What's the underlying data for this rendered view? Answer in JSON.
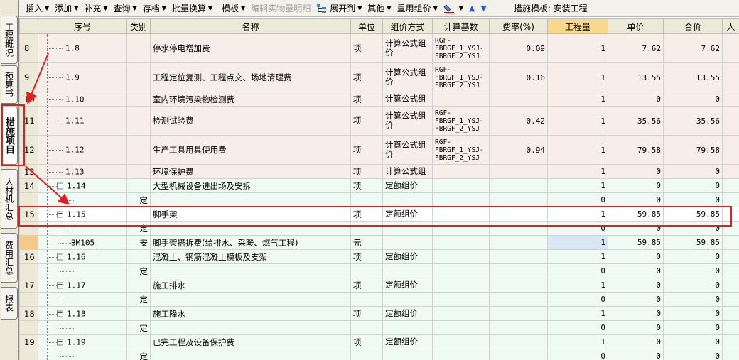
{
  "sidebar": {
    "tabs": [
      {
        "label": "工程概况",
        "active": false
      },
      {
        "label": "预算书",
        "active": false
      },
      {
        "label": "措施项目",
        "active": true
      },
      {
        "label": "人材机汇总",
        "active": false
      },
      {
        "label": "费用汇总",
        "active": false
      },
      {
        "label": "报表",
        "active": false
      }
    ]
  },
  "toolbar": {
    "insert": "插入",
    "add": "添加",
    "supplement": "补充",
    "query": "查询",
    "archive": "存档",
    "batch_convert": "批量换算",
    "template": "模板",
    "edit_material": "编辑实物量明细",
    "expand_to": "展开到",
    "other": "其他",
    "regroup": "重用组价",
    "template_label": "措施模板: 安装工程"
  },
  "columns": [
    "",
    "序号",
    "类别",
    "名称",
    "单位",
    "组价方式",
    "计算基数",
    "费率(%)",
    "工程量",
    "单价",
    "合价",
    "人"
  ],
  "rows": [
    {
      "n": "8",
      "code": "1.8",
      "cat": "",
      "name": "停水停电增加费",
      "unit": "项",
      "method": "计算公式组价",
      "base": "RGF-FBRGF_1_YSJ-FBRGF_2_YSJ",
      "rate": "0.09",
      "qty": "1",
      "price": "7.62",
      "total": "7.62"
    },
    {
      "n": "9",
      "code": "1.9",
      "cat": "",
      "name": "工程定位复测、工程点交、场地清理费",
      "unit": "项",
      "method": "计算公式组价",
      "base": "RGF-FBRGF_1_YSJ-FBRGF_2_YSJ",
      "rate": "0.16",
      "qty": "1",
      "price": "13.55",
      "total": "13.55"
    },
    {
      "n": "10",
      "code": "1.10",
      "cat": "",
      "name": "室内环境污染物检测费",
      "unit": "项",
      "method": "计算公式组",
      "base": "",
      "rate": "",
      "qty": "1",
      "price": "0",
      "total": "0"
    },
    {
      "n": "11",
      "code": "1.11",
      "cat": "",
      "name": "检测试验费",
      "unit": "项",
      "method": "计算公式组价",
      "base": "RGF-FBRGF_1_YSJ-FBRGF_2_YSJ",
      "rate": "0.42",
      "qty": "1",
      "price": "35.56",
      "total": "35.56"
    },
    {
      "n": "12",
      "code": "1.12",
      "cat": "",
      "name": "生产工具用具使用费",
      "unit": "项",
      "method": "计算公式组价",
      "base": "RGF-FBRGF_1_YSJ-FBRGF_2_YSJ",
      "rate": "0.94",
      "qty": "1",
      "price": "79.58",
      "total": "79.58"
    },
    {
      "n": "13",
      "code": "1.13",
      "cat": "",
      "name": "环境保护费",
      "unit": "项",
      "method": "计算公式组",
      "base": "",
      "rate": "",
      "qty": "1",
      "price": "0",
      "total": "0"
    },
    {
      "n": "14",
      "code": "1.14",
      "cat": "",
      "name": "大型机械设备进出场及安拆",
      "unit": "项",
      "method": "定额组价",
      "base": "",
      "rate": "",
      "qty": "1",
      "price": "0",
      "total": "0"
    },
    {
      "n": "",
      "code": "",
      "cat": "定",
      "name": "",
      "unit": "",
      "method": "",
      "base": "",
      "rate": "",
      "qty": "0",
      "price": "0",
      "total": "0"
    },
    {
      "n": "15",
      "code": "1.15",
      "cat": "",
      "name": "脚手架",
      "unit": "项",
      "method": "定额组价",
      "base": "",
      "rate": "",
      "qty": "1",
      "price": "59.85",
      "total": "59.85"
    },
    {
      "n": "",
      "code": "",
      "cat": "定",
      "name": "",
      "unit": "",
      "method": "",
      "base": "",
      "rate": "",
      "qty": "0",
      "price": "0",
      "total": "0"
    },
    {
      "n": "",
      "code": "BM105",
      "cat": "安",
      "name": "脚手架搭拆费(给排水、采暖、燃气工程)",
      "unit": "元",
      "method": "",
      "base": "",
      "rate": "",
      "qty": "1",
      "price": "59.85",
      "total": "59.85"
    },
    {
      "n": "16",
      "code": "1.16",
      "cat": "",
      "name": "混凝土、钢筋混凝土模板及支架",
      "unit": "项",
      "method": "定额组价",
      "base": "",
      "rate": "",
      "qty": "1",
      "price": "0",
      "total": "0"
    },
    {
      "n": "",
      "code": "",
      "cat": "定",
      "name": "",
      "unit": "",
      "method": "",
      "base": "",
      "rate": "",
      "qty": "0",
      "price": "0",
      "total": "0"
    },
    {
      "n": "17",
      "code": "1.17",
      "cat": "",
      "name": "施工排水",
      "unit": "项",
      "method": "定额组价",
      "base": "",
      "rate": "",
      "qty": "1",
      "price": "0",
      "total": "0"
    },
    {
      "n": "",
      "code": "",
      "cat": "定",
      "name": "",
      "unit": "",
      "method": "",
      "base": "",
      "rate": "",
      "qty": "0",
      "price": "0",
      "total": "0"
    },
    {
      "n": "18",
      "code": "1.18",
      "cat": "",
      "name": "施工降水",
      "unit": "项",
      "method": "定额组价",
      "base": "",
      "rate": "",
      "qty": "1",
      "price": "0",
      "total": "0"
    },
    {
      "n": "",
      "code": "",
      "cat": "定",
      "name": "",
      "unit": "",
      "method": "",
      "base": "",
      "rate": "",
      "qty": "0",
      "price": "0",
      "total": "0"
    },
    {
      "n": "19",
      "code": "1.19",
      "cat": "",
      "name": "已完工程及设备保护费",
      "unit": "项",
      "method": "定额组价",
      "base": "",
      "rate": "",
      "qty": "1",
      "price": "0",
      "total": "0"
    },
    {
      "n": "",
      "code": "",
      "cat": "定",
      "name": "",
      "unit": "",
      "method": "",
      "base": "",
      "rate": "",
      "qty": "0",
      "price": "0",
      "total": "0"
    }
  ]
}
